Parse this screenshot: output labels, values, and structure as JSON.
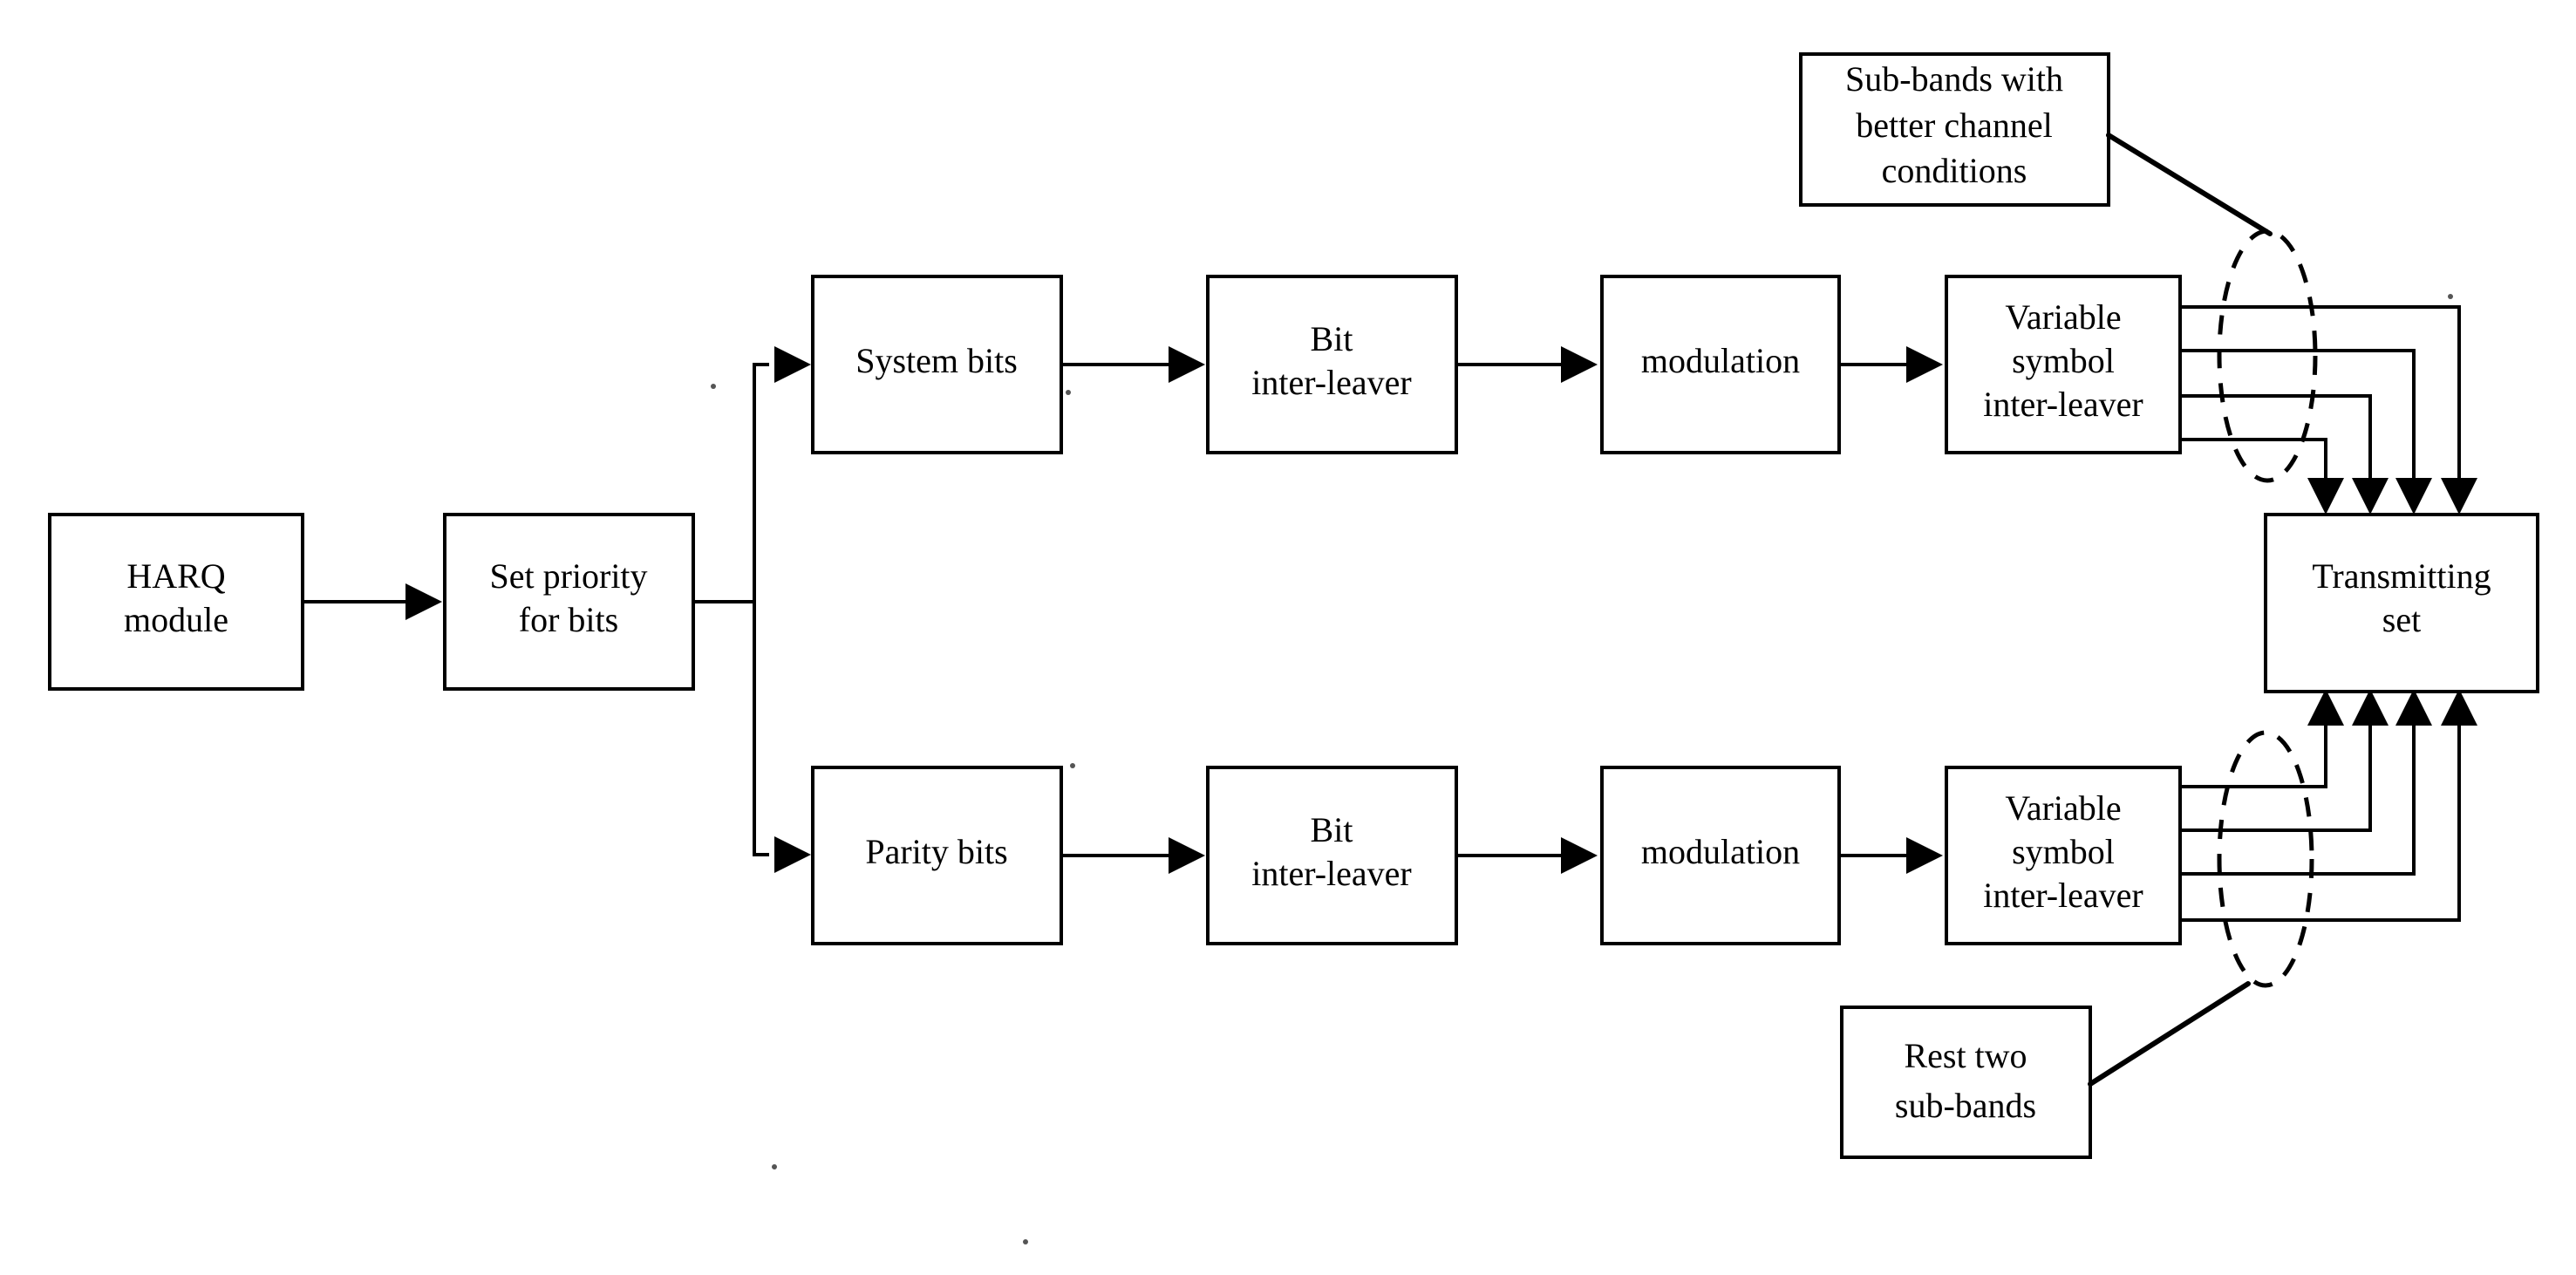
{
  "diagram": {
    "title": "HARQ bit-priority transmission block diagram",
    "stroke_color": "#000000",
    "fill_color": "#ffffff",
    "background": "#ffffff",
    "boxes": {
      "harq_module": {
        "line1": "HARQ",
        "line2": "module"
      },
      "set_priority": {
        "line1": "Set priority",
        "line2": "for bits"
      },
      "system_bits": {
        "line1": "System bits"
      },
      "bit_interleaver_top": {
        "line1": "Bit",
        "line2": "inter-leaver"
      },
      "modulation_top": {
        "line1": "modulation"
      },
      "variable_symbol_interleaver_top": {
        "line1": "Variable",
        "line2": "symbol",
        "line3": "inter-leaver"
      },
      "parity_bits": {
        "line1": "Parity bits"
      },
      "bit_interleaver_bottom": {
        "line1": "Bit",
        "line2": "inter-leaver"
      },
      "modulation_bottom": {
        "line1": "modulation"
      },
      "variable_symbol_interleaver_bottom": {
        "line1": "Variable",
        "line2": "symbol",
        "line3": "inter-leaver"
      },
      "transmitting_set": {
        "line1": "Transmitting",
        "line2": "set"
      },
      "subbands_better": {
        "line1": "Sub-bands with",
        "line2": "better channel",
        "line3": "conditions"
      },
      "rest_two_subbands": {
        "line1": "Rest two",
        "line2": "sub-bands"
      }
    }
  }
}
